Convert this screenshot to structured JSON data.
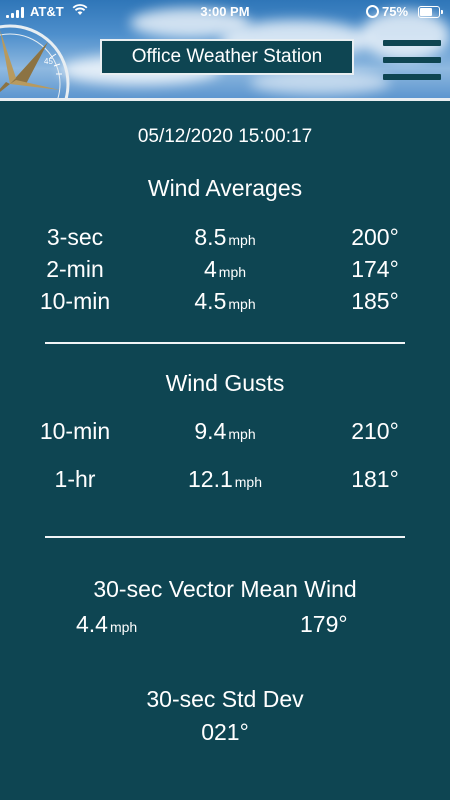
{
  "status_bar": {
    "carrier": "AT&T",
    "time": "3:00 PM",
    "battery_percent": "75%",
    "battery_level": 0.75,
    "icons": [
      "signal-icon",
      "wifi-icon",
      "alarm-icon",
      "battery-icon"
    ]
  },
  "header": {
    "title": "Office Weather Station",
    "menu_icon": "hamburger-menu-icon",
    "compass_label": "45"
  },
  "timestamp": "05/12/2020 15:00:17",
  "wind_averages": {
    "title": "Wind Averages",
    "rows": [
      {
        "label": "3-sec",
        "speed": "8.5",
        "unit": "mph",
        "direction": "200°"
      },
      {
        "label": "2-min",
        "speed": "4",
        "unit": "mph",
        "direction": "174°"
      },
      {
        "label": "10-min",
        "speed": "4.5",
        "unit": "mph",
        "direction": "185°"
      }
    ]
  },
  "wind_gusts": {
    "title": "Wind Gusts",
    "rows": [
      {
        "label": "10-min",
        "speed": "9.4",
        "unit": "mph",
        "direction": "210°"
      },
      {
        "label": "1-hr",
        "speed": "12.1",
        "unit": "mph",
        "direction": "181°"
      }
    ]
  },
  "vector_mean": {
    "title": "30-sec Vector Mean Wind",
    "speed": "4.4",
    "unit": "mph",
    "direction": "179°"
  },
  "std_dev": {
    "title": "30-sec Std Dev",
    "value": "021°"
  },
  "colors": {
    "background": "#0e4552",
    "text": "#ffffff",
    "accent_gold": "#b89a5e"
  }
}
